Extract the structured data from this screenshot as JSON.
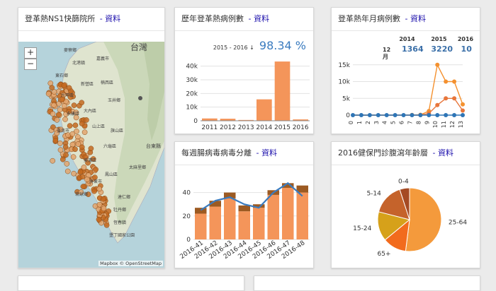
{
  "map_card": {
    "title": "登革熱NS1快篩院所",
    "link": "- 資料",
    "zoom_in": "+",
    "zoom_out": "−",
    "labels": {
      "taiwan": "台灣",
      "chiayi": "嘉義市",
      "yunlin": "麥寮鄉",
      "tainan1": "北港鎮",
      "ts1": "東石鄉",
      "ts2": "新營區",
      "ts3": "楠西區",
      "ts4": "玉井鄉",
      "ts5": "六甲區",
      "ts6": "大內區",
      "ts7": "永康區",
      "ts8": "山上區",
      "ts9": "臺南市",
      "ts10": "旗山區",
      "ts11": "六龜區",
      "ts12": "美濃區",
      "ts13": "鳳山區",
      "ts14": "屏東市",
      "ts15": "台東縣",
      "ts16": "太麻里鄉",
      "ts17": "琉球鄉",
      "ts18": "達仁鄉",
      "ts19": "牡丹鄉",
      "ts20": "恆春鎮",
      "ts21": "墾丁國家公園"
    },
    "attribution": "Mapbox © OpenStreetMap"
  },
  "yearly_card": {
    "title": "歷年登革熱病例數",
    "link": "- 資料",
    "range_label": "2015 - 2016 ↓",
    "percent": "98.34 %",
    "bar_color": "#f4955a",
    "chart_data": {
      "type": "bar",
      "categories": [
        "2011",
        "2012",
        "2013",
        "2014",
        "2015",
        "2016"
      ],
      "values": [
        1700,
        1500,
        600,
        15700,
        43400,
        1000
      ],
      "ylim": [
        0,
        45000
      ],
      "yticks": [
        "0",
        "10k",
        "20k",
        "30k",
        "40k"
      ],
      "ytick_values": [
        0,
        10000,
        20000,
        30000,
        40000
      ],
      "grid": true
    }
  },
  "monthly_card": {
    "title": "登革熱年月病例數",
    "link": "- 資料",
    "summary": {
      "years": [
        "2014",
        "2015",
        "2016"
      ],
      "month_label": "12月",
      "values": [
        "1364",
        "3220",
        "10"
      ]
    },
    "chart_data": {
      "type": "line",
      "x": [
        0,
        1,
        2,
        3,
        4,
        5,
        6,
        7,
        8,
        9,
        10,
        11,
        12,
        13
      ],
      "xlabels": [
        "0",
        "1",
        "2",
        "3",
        "4",
        "5",
        "6",
        "7",
        "8",
        "9",
        "10",
        "11",
        "12",
        "13"
      ],
      "series": [
        {
          "color": "#f4912f",
          "values": [
            0,
            0,
            0,
            0,
            0,
            0,
            0,
            50,
            100,
            1200,
            15000,
            10000,
            10000,
            3220
          ]
        },
        {
          "color": "#e8763b",
          "values": [
            0,
            0,
            0,
            0,
            0,
            0,
            0,
            0,
            10,
            500,
            3000,
            5000,
            5000,
            1364
          ]
        },
        {
          "color": "#2e75b6",
          "values": [
            0,
            0,
            0,
            0,
            0,
            0,
            0,
            0,
            0,
            0,
            0,
            0,
            0,
            10
          ]
        }
      ],
      "ylim": [
        0,
        16000
      ],
      "yticks": [
        "0",
        "5k",
        "10k",
        "15k"
      ],
      "ytick_values": [
        0,
        5000,
        10000,
        15000
      ],
      "grid": true
    }
  },
  "enterovirus_card": {
    "title": "每週腸病毒病毒分離",
    "link": "- 資料",
    "chart_data": {
      "type": "bar",
      "categories": [
        "2016-41",
        "2016-42",
        "2016-43",
        "2016-44",
        "2016-45",
        "2016-46",
        "2016-47",
        "2016-48"
      ],
      "series": [
        {
          "color": "#f4955a",
          "values": [
            22,
            28,
            35,
            24,
            27,
            38,
            44,
            40
          ]
        },
        {
          "color": "#9c5a22",
          "values": [
            5,
            5,
            5,
            5,
            3,
            4,
            4,
            6
          ]
        }
      ],
      "line": {
        "color": "#3a7bbf",
        "values": [
          25,
          33,
          36,
          30,
          27,
          40,
          48,
          37
        ]
      },
      "ylim": [
        0,
        50
      ],
      "yticks": [
        "0",
        "20",
        "40"
      ],
      "ytick_values": [
        0,
        20,
        40
      ],
      "grid": true
    }
  },
  "age_card": {
    "title": "2016健保門診腹瀉年齡層",
    "link": "- 資料",
    "chart_data": {
      "type": "pie",
      "labels": [
        "25-64",
        "65+",
        "15-24",
        "5-14",
        "0-4"
      ],
      "values": [
        52,
        12,
        15,
        16,
        5
      ],
      "colors": [
        "#f49a3c",
        "#f26b1d",
        "#d6a11a",
        "#c5632b",
        "#a54a23"
      ]
    }
  }
}
